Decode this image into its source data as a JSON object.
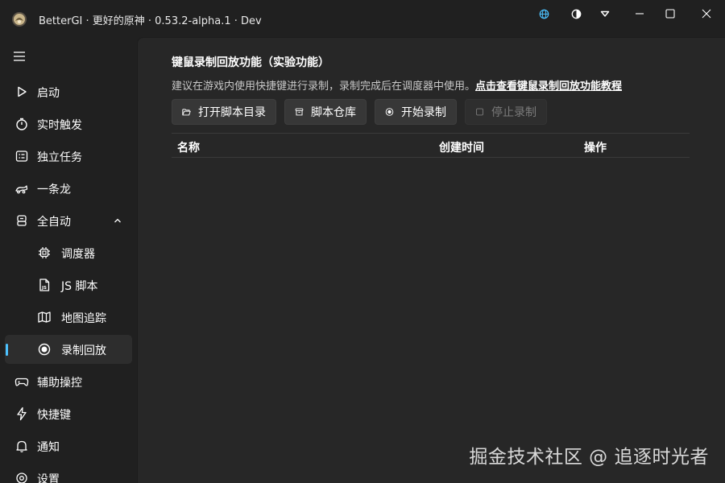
{
  "window": {
    "title": "BetterGI · 更好的原神 · 0.53.2-alpha.1 · Dev",
    "accent_color": "#4cc2ff",
    "controls": {
      "language_icon": "globe-icon",
      "theme_icon": "contrast-icon",
      "menu_icon": "dropdown-triangle-icon",
      "minimize_icon": "minimize-icon",
      "maximize_icon": "maximize-icon",
      "close_icon": "close-icon"
    }
  },
  "sidebar": {
    "items": [
      {
        "label": "启动",
        "icon": "play-icon"
      },
      {
        "label": "实时触发",
        "icon": "stopwatch-icon"
      },
      {
        "label": "独立任务",
        "icon": "task-list-icon"
      },
      {
        "label": "一条龙",
        "icon": "dragon-icon"
      },
      {
        "label": "全自动",
        "icon": "robot-icon",
        "expanded": true
      },
      {
        "label": "调度器",
        "icon": "chip-icon",
        "sub": true
      },
      {
        "label": "JS 脚本",
        "icon": "js-file-icon",
        "sub": true
      },
      {
        "label": "地图追踪",
        "icon": "map-icon",
        "sub": true
      },
      {
        "label": "录制回放",
        "icon": "record-icon",
        "sub": true,
        "selected": true
      },
      {
        "label": "辅助操控",
        "icon": "gamepad-icon"
      },
      {
        "label": "快捷键",
        "icon": "flash-icon"
      },
      {
        "label": "通知",
        "icon": "bell-icon"
      },
      {
        "label": "设置",
        "icon": "settings-icon"
      }
    ]
  },
  "main": {
    "heading": "键鼠录制回放功能（实验功能）",
    "description": "建议在游戏内使用快捷键进行录制，录制完成后在调度器中使用。",
    "tutorial_link": "点击查看键鼠录制回放功能教程",
    "buttons": {
      "open_folder": "打开脚本目录",
      "repository": "脚本仓库",
      "start_recording": "开始录制",
      "stop_recording": "停止录制"
    },
    "table": {
      "columns": [
        "名称",
        "创建时间",
        "操作"
      ],
      "rows": []
    }
  },
  "watermark": "掘金技术社区 @ 追逐时光者"
}
